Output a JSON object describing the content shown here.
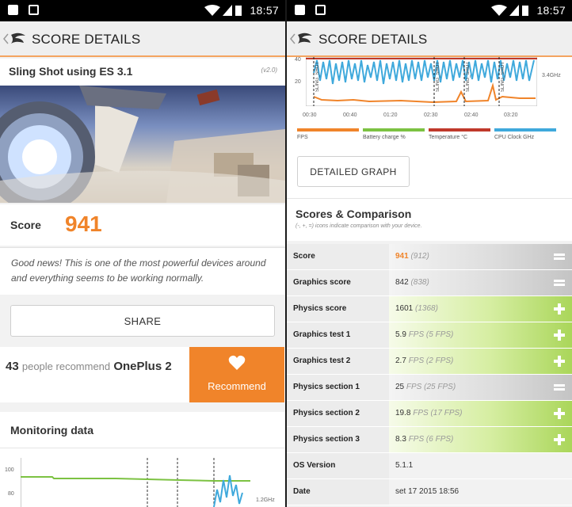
{
  "status": {
    "time": "18:57"
  },
  "appbar": {
    "title": "SCORE DETAILS"
  },
  "left": {
    "test_title": "Sling Shot using ES 3.1",
    "version": "(v2.0)",
    "score_label": "Score",
    "score_value": "941",
    "message": "Good news! This is one of the most powerful devices around and everything seems to be working normally.",
    "share_label": "SHARE",
    "recommend_count": "43",
    "recommend_text": "people recommend",
    "recommend_device": "OnePlus 2",
    "recommend_button": "Recommend",
    "monitoring_title": "Monitoring data",
    "graph_y_ticks": [
      "100",
      "80"
    ],
    "graph_right_label": "1.2GHz"
  },
  "right": {
    "graph_y_ticks": [
      "40",
      "20"
    ],
    "graph_right_label": "3.4GHz",
    "graph_markers": [
      "SLING_SHOT",
      "SLING_SHOT",
      "SLING_SHOT",
      "SLING_SHOT"
    ],
    "x_ticks": [
      "00:30",
      "00:40",
      "01:20",
      "02:30",
      "02:40",
      "03:20"
    ],
    "legend": [
      {
        "label": "FPS",
        "color": "#f0842a"
      },
      {
        "label": "Battery charge %",
        "color": "#7cc242"
      },
      {
        "label": "Temperature °C",
        "color": "#c0392b"
      },
      {
        "label": "CPU Clock GHz",
        "color": "#3fa9dc"
      }
    ],
    "detailed_graph_label": "DETAILED GRAPH",
    "comparison_title": "Scores & Comparison",
    "comparison_sub": "(-, +, =) icons indicate comparison with your device.",
    "rows": [
      {
        "label": "Score",
        "value": "941",
        "compare": "(912)",
        "indicator": "equal"
      },
      {
        "label": "Graphics score",
        "value": "842",
        "compare": "(838)",
        "indicator": "equal"
      },
      {
        "label": "Physics score",
        "value": "1601",
        "compare": "(1368)",
        "indicator": "plus"
      },
      {
        "label": "Graphics test 1",
        "value": "5.9",
        "compare": "FPS (5 FPS)",
        "indicator": "plus"
      },
      {
        "label": "Graphics test 2",
        "value": "2.7",
        "compare": "FPS (2 FPS)",
        "indicator": "plus"
      },
      {
        "label": "Physics section 1",
        "value": "25",
        "compare": "FPS (25 FPS)",
        "indicator": "equal"
      },
      {
        "label": "Physics section 2",
        "value": "19.8",
        "compare": "FPS (17 FPS)",
        "indicator": "plus"
      },
      {
        "label": "Physics section 3",
        "value": "8.3",
        "compare": "FPS (6 FPS)",
        "indicator": "plus"
      },
      {
        "label": "OS Version",
        "value": "5.1.1",
        "compare": "",
        "indicator": "none"
      },
      {
        "label": "Date",
        "value": "set 17 2015 18:56",
        "compare": "",
        "indicator": "none"
      }
    ]
  }
}
